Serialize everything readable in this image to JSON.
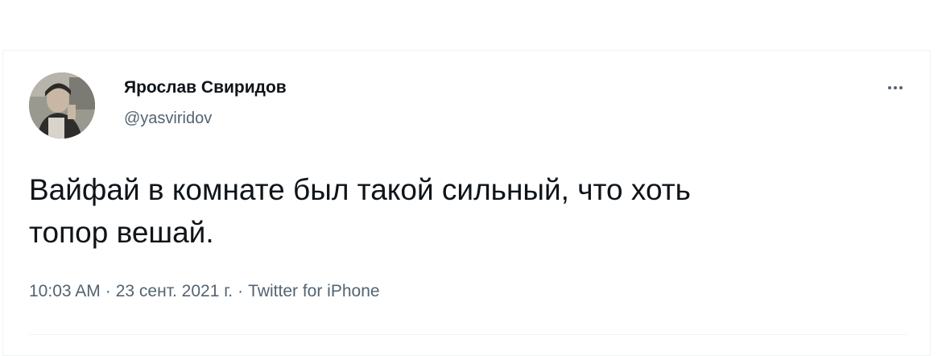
{
  "tweet": {
    "author": {
      "display_name": "Ярослав Свиридов",
      "handle": "@yasviridov",
      "avatar_icon": "user-photo-avatar"
    },
    "text": "Вайфай в комнате был такой сильный, что хоть\nтопор вешай.",
    "time": "10:03 AM",
    "date": "23 сент. 2021 г.",
    "separator": "·",
    "source": "Twitter for iPhone",
    "more_icon": "more-horizontal-icon"
  },
  "colors": {
    "text_primary": "#0f1419",
    "text_secondary": "#536471",
    "border": "#eff3f4"
  }
}
